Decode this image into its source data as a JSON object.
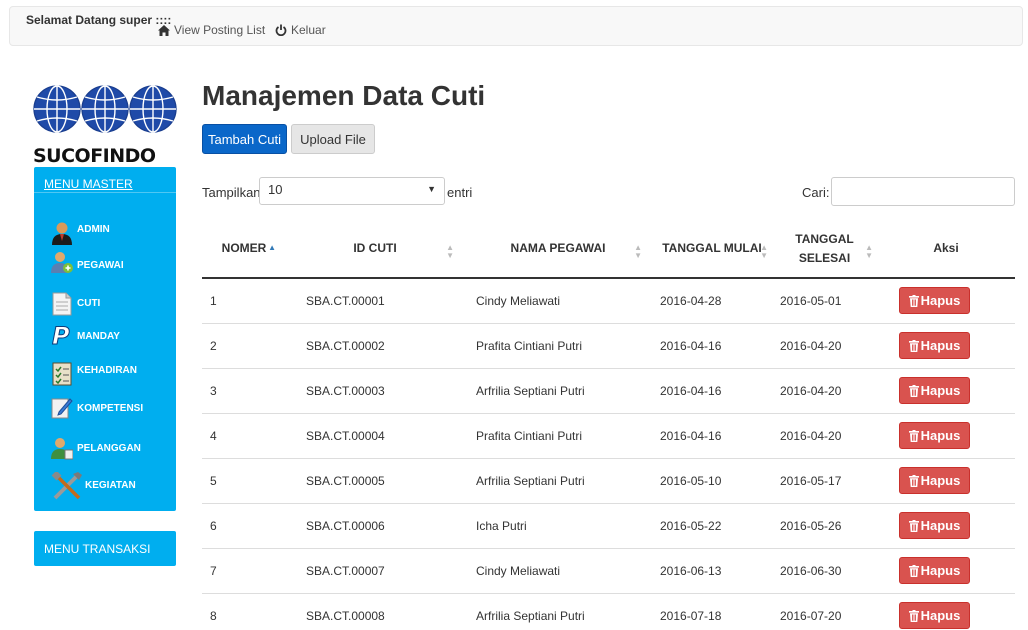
{
  "navbar": {
    "greeting": "Selamat Datang super ::::",
    "view_posting": "View Posting List",
    "logout": "Keluar"
  },
  "logo": {
    "text": "SUCOFINDO"
  },
  "sidebar": {
    "master_header": "MENU MASTER",
    "items": [
      {
        "label": "ADMIN",
        "icon": "admin-user-icon"
      },
      {
        "label": "PEGAWAI",
        "icon": "employee-icon"
      },
      {
        "label": "CUTI",
        "icon": "document-icon"
      },
      {
        "label": "MANDAY",
        "icon": "paypal-icon"
      },
      {
        "label": "KEHADIRAN",
        "icon": "checklist-icon"
      },
      {
        "label": "KOMPETENSI",
        "icon": "edit-icon"
      },
      {
        "label": "PELANGGAN",
        "icon": "customer-icon"
      },
      {
        "label": "KEGIATAN",
        "icon": "tools-icon"
      }
    ],
    "trans_header": "MENU TRANSAKSI"
  },
  "main": {
    "title": "Manajemen Data Cuti",
    "add_button": "Tambah Cuti",
    "upload_button": "Upload File",
    "length_label": "Tampilkan",
    "length_value": "10",
    "length_after": "entri",
    "search_label": "Cari:"
  },
  "table": {
    "headers": [
      "NOMER",
      "ID CUTI",
      "NAMA PEGAWAI",
      "TANGGAL MULAI",
      "TANGGAL SELESAI",
      "Aksi"
    ],
    "delete_label": "Hapus",
    "rows": [
      [
        "1",
        "SBA.CT.00001",
        "Cindy Meliawati",
        "2016-04-28",
        "2016-05-01"
      ],
      [
        "2",
        "SBA.CT.00002",
        "Prafita Cintiani Putri",
        "2016-04-16",
        "2016-04-20"
      ],
      [
        "3",
        "SBA.CT.00003",
        "Arfrilia Septiani Putri",
        "2016-04-16",
        "2016-04-20"
      ],
      [
        "4",
        "SBA.CT.00004",
        "Prafita Cintiani Putri",
        "2016-04-16",
        "2016-04-20"
      ],
      [
        "5",
        "SBA.CT.00005",
        "Arfrilia Septiani Putri",
        "2016-05-10",
        "2016-05-17"
      ],
      [
        "6",
        "SBA.CT.00006",
        "Icha Putri",
        "2016-05-22",
        "2016-05-26"
      ],
      [
        "7",
        "SBA.CT.00007",
        "Cindy Meliawati",
        "2016-06-13",
        "2016-06-30"
      ],
      [
        "8",
        "SBA.CT.00008",
        "Arfrilia Septiani Putri",
        "2016-07-18",
        "2016-07-20"
      ]
    ]
  },
  "colors": {
    "sidebar": "#00aeef",
    "primary": "#0a67c9",
    "danger": "#d9534f"
  }
}
